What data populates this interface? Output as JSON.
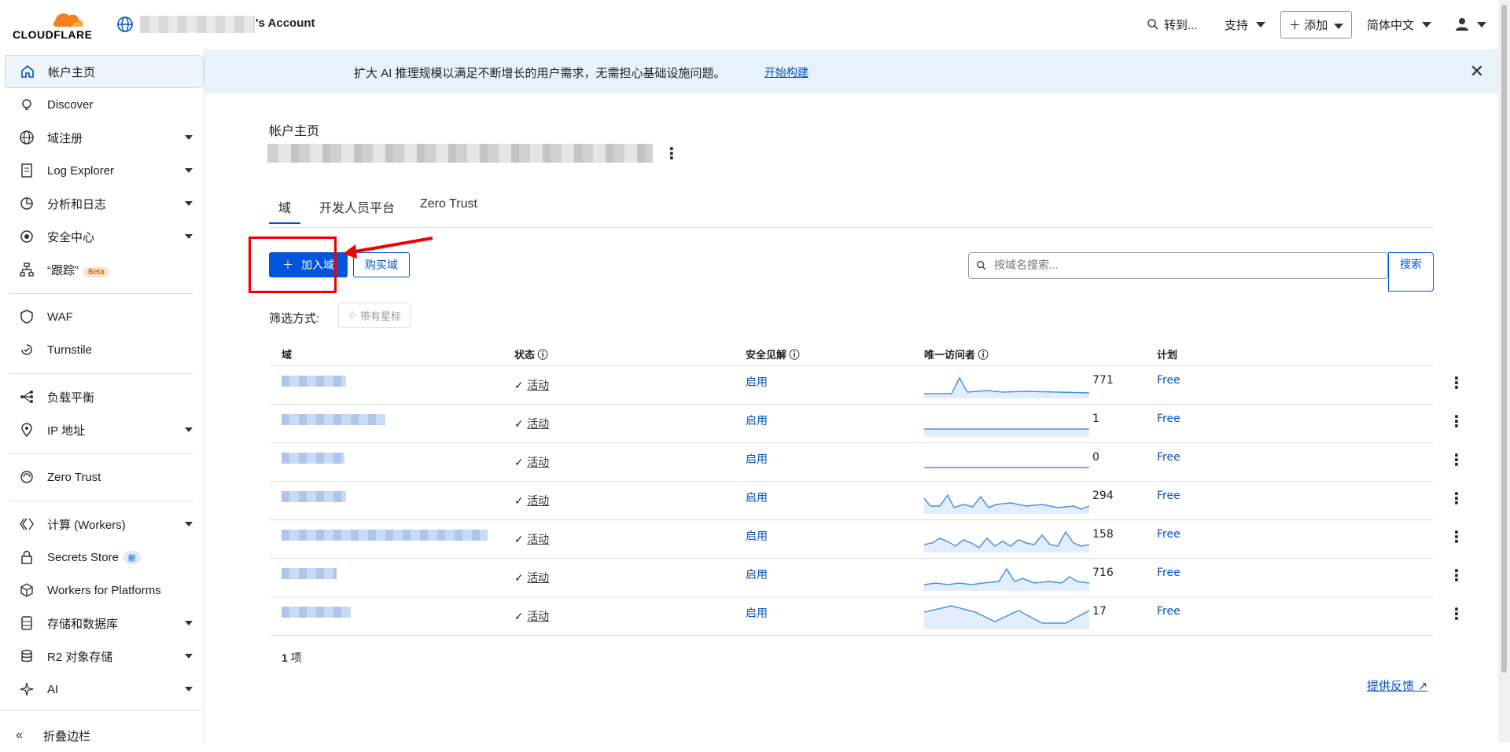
{
  "topbar": {
    "logo_text": "CLOUDFLARE",
    "account_suffix": "'s Account",
    "goto": "转到...",
    "support": "支持",
    "add": "添加",
    "language": "简体中文"
  },
  "banner": {
    "text": "扩大 AI 推理规模以满足不断增长的用户需求，无需担心基础设施问题。",
    "link": "开始构建"
  },
  "sidebar": {
    "items": [
      {
        "label": "帐户主页",
        "icon": "home-icon"
      },
      {
        "label": "Discover",
        "icon": "lightbulb-icon"
      },
      {
        "label": "域注册",
        "icon": "globe-icon"
      },
      {
        "label": "Log Explorer",
        "icon": "log-icon"
      },
      {
        "label": "分析和日志",
        "icon": "pie-chart-icon"
      },
      {
        "label": "安全中心",
        "icon": "security-icon"
      },
      {
        "label": "“跟踪”",
        "icon": "trace-icon",
        "badge": "Beta"
      },
      {
        "label": "WAF",
        "icon": "waf-icon"
      },
      {
        "label": "Turnstile",
        "icon": "turnstile-icon"
      },
      {
        "label": "负载平衡",
        "icon": "load-balancer-icon"
      },
      {
        "label": "IP 地址",
        "icon": "location-pin-icon"
      },
      {
        "label": "Zero Trust",
        "icon": "zero-trust-icon"
      },
      {
        "label": "计算 (Workers)",
        "icon": "workers-icon"
      },
      {
        "label": "Secrets Store",
        "icon": "lock-icon",
        "badge": "新"
      },
      {
        "label": "Workers for Platforms",
        "icon": "cube-icon"
      },
      {
        "label": "存储和数据库",
        "icon": "storage-icon"
      },
      {
        "label": "R2 对象存储",
        "icon": "database-icon"
      },
      {
        "label": "AI",
        "icon": "sparkle-icon"
      }
    ],
    "collapse": "折叠边栏"
  },
  "main": {
    "title": "帐户主页",
    "tabs": [
      "域",
      "开发人员平台",
      "Zero Trust"
    ],
    "add_domain": "加入域",
    "buy_domain": "购买域",
    "search_placeholder": "按域名搜索...",
    "search_button": "搜索",
    "filter_label": "筛选方式:",
    "filter_starred": "带有星标",
    "columns": [
      "域",
      "状态",
      "安全见解",
      "唯一访问者",
      "计划"
    ],
    "rows": [
      {
        "status": "活动",
        "security": "启用",
        "visitors": "771",
        "plan": "Free"
      },
      {
        "status": "活动",
        "security": "启用",
        "visitors": "1",
        "plan": "Free"
      },
      {
        "status": "活动",
        "security": "启用",
        "visitors": "0",
        "plan": "Free"
      },
      {
        "status": "活动",
        "security": "启用",
        "visitors": "294",
        "plan": "Free"
      },
      {
        "status": "活动",
        "security": "启用",
        "visitors": "158",
        "plan": "Free"
      },
      {
        "status": "活动",
        "security": "启用",
        "visitors": "716",
        "plan": "Free"
      },
      {
        "status": "活动",
        "security": "启用",
        "visitors": "17",
        "plan": "Free"
      }
    ],
    "count_value": "1",
    "count_unit": "项",
    "feedback": "提供反馈"
  },
  "colors": {
    "accent": "#0055dc",
    "link": "#0051c3",
    "banner_bg": "#e6f3fb",
    "annotation_red": "#e00000",
    "logo_orange": "#f38020"
  }
}
